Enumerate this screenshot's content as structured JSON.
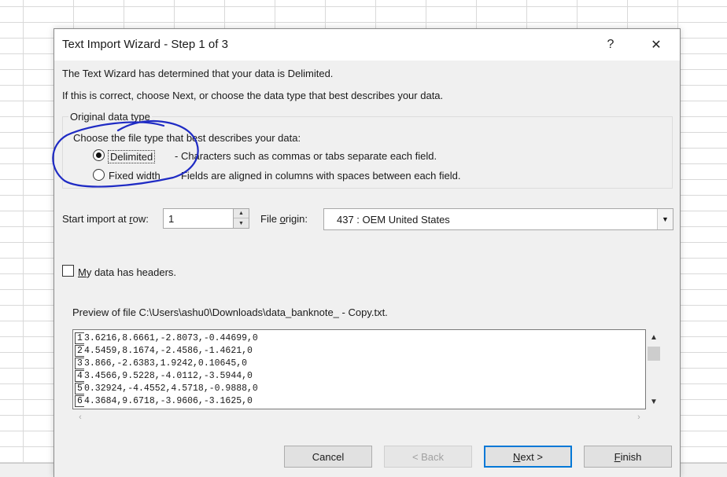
{
  "dialog": {
    "title": "Text Import Wizard - Step 1 of 3",
    "help_glyph": "?",
    "close_glyph": "✕"
  },
  "intro": {
    "line1": "The Text Wizard has determined that your data is Delimited.",
    "line2": "If this is correct, choose Next, or choose the data type that best describes your data."
  },
  "original_data_type": {
    "legend": "Original data type",
    "prompt": "Choose the file type that best describes your data:",
    "options": [
      {
        "label": "Delimited",
        "description": "- Characters such as commas or tabs separate each field.",
        "selected": true
      },
      {
        "label": "Fixed width",
        "description": "- Fields are aligned in columns with spaces between each field.",
        "selected": false
      }
    ]
  },
  "start_import": {
    "label_pre": "Start import at ",
    "label_key": "r",
    "label_post": "ow:",
    "value": "1"
  },
  "file_origin": {
    "label_pre": "File ",
    "label_key": "o",
    "label_post": "rigin:",
    "value": "437 : OEM United States"
  },
  "headers_checkbox": {
    "label_key": "M",
    "label_rest": "y data has headers.",
    "checked": false
  },
  "preview": {
    "label": "Preview of file C:\\Users\\ashu0\\Downloads\\data_banknote_ - Copy.txt.",
    "rows": [
      {
        "num": "1",
        "text": "3.6216,8.6661,-2.8073,-0.44699,0"
      },
      {
        "num": "2",
        "text": "4.5459,8.1674,-2.4586,-1.4621,0"
      },
      {
        "num": "3",
        "text": "3.866,-2.6383,1.9242,0.10645,0"
      },
      {
        "num": "4",
        "text": "3.4566,9.5228,-4.0112,-3.5944,0"
      },
      {
        "num": "5",
        "text": "0.32924,-4.4552,4.5718,-0.9888,0"
      },
      {
        "num": "6",
        "text": "4.3684,9.6718,-3.9606,-3.1625,0"
      }
    ]
  },
  "buttons": {
    "cancel": "Cancel",
    "back": "< Back",
    "next_key": "N",
    "next_rest": "ext >",
    "finish_key": "F",
    "finish_rest": "inish"
  },
  "colors": {
    "accent": "#0078d7",
    "annotation_ink": "#1f2bc4"
  }
}
